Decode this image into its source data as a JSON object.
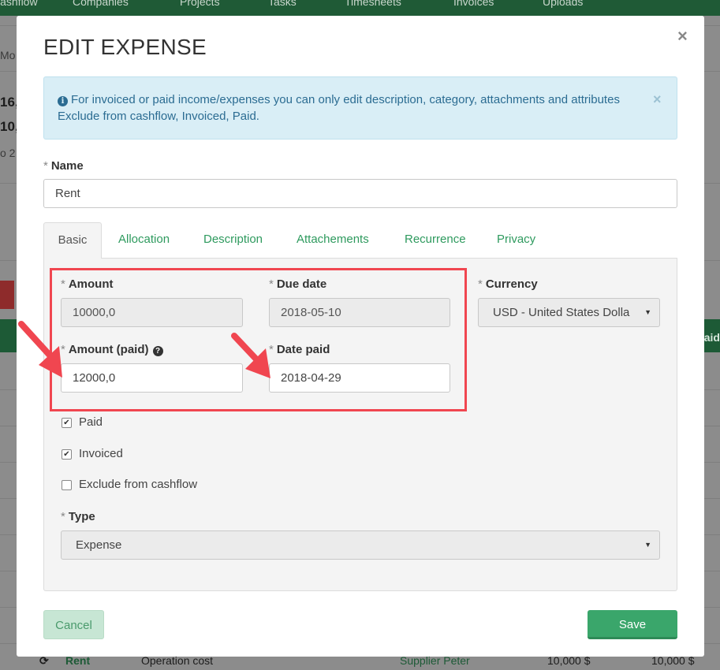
{
  "background": {
    "nav_items": [
      "Cashflow",
      "Companies",
      "Projects",
      "Tasks",
      "Timesheets",
      "Invoices",
      "Uploads"
    ],
    "left_fragments": [
      "Mo",
      "16,",
      "10,",
      "o 2"
    ],
    "right_fragment": "Paid",
    "bottom_row": [
      "Rent",
      "Operation cost",
      "Supplier Peter",
      "10,000 $",
      "10,000 $"
    ]
  },
  "modal": {
    "title": "EDIT EXPENSE",
    "close_glyph": "×",
    "alert": {
      "text": "For invoiced or paid income/expenses you can only edit description, category, attachments and attributes Exclude from cashflow, Invoiced, Paid.",
      "close_glyph": "×"
    },
    "name": {
      "required_mark": "*",
      "label": "Name",
      "value": "Rent"
    },
    "tabs": [
      "Basic",
      "Allocation",
      "Description",
      "Attachements",
      "Recurrence",
      "Privacy"
    ],
    "active_tab": "Basic",
    "fields": {
      "amount": {
        "required_mark": "*",
        "label": "Amount",
        "value": "10000,0"
      },
      "due_date": {
        "required_mark": "*",
        "label": "Due date",
        "value": "2018-05-10"
      },
      "currency": {
        "required_mark": "*",
        "label": "Currency",
        "value": "USD - United States Dolla"
      },
      "amount_paid": {
        "required_mark": "*",
        "label": "Amount (paid)",
        "value": "12000,0"
      },
      "date_paid": {
        "required_mark": "*",
        "label": "Date paid",
        "value": "2018-04-29"
      },
      "type": {
        "required_mark": "*",
        "label": "Type",
        "value": "Expense"
      }
    },
    "checkboxes": [
      {
        "label": "Paid",
        "checked": true,
        "glyph": "✔"
      },
      {
        "label": "Invoiced",
        "checked": true,
        "glyph": "✔"
      },
      {
        "label": "Exclude from cashflow",
        "checked": false,
        "glyph": ""
      }
    ],
    "icons": {
      "help": "?",
      "info": "i",
      "caret": "▼"
    },
    "buttons": {
      "cancel": "Cancel",
      "save": "Save"
    }
  },
  "colors": {
    "accent_green": "#3aa66b",
    "tab_link": "#2e9a5e",
    "highlight_red": "#f04650",
    "alert_bg": "#d9eef6",
    "alert_text": "#2b6c92"
  }
}
